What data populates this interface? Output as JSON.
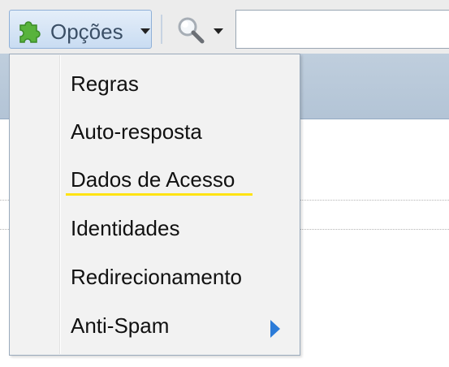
{
  "toolbar": {
    "options_button": {
      "label": "Opções",
      "icon": "puzzle-icon"
    },
    "search_button": {
      "icon": "magnifier-icon"
    },
    "search_input": {
      "value": "",
      "placeholder": ""
    }
  },
  "menu": {
    "items": [
      {
        "label": "Regras"
      },
      {
        "label": "Auto-resposta"
      },
      {
        "label": "Dados de Acesso",
        "highlighted": true,
        "highlight_color": "#ffe313"
      },
      {
        "label": "Identidades"
      },
      {
        "label": "Redirecionamento"
      },
      {
        "label": "Anti-Spam",
        "has_submenu": true,
        "submenu_arrow_color": "#2b7bd8"
      }
    ]
  },
  "colors": {
    "toolbar_bg": "#ececec",
    "header_band": "#bfcedd",
    "menu_bg": "#f2f2f2",
    "button_border": "#8fb0d8"
  }
}
